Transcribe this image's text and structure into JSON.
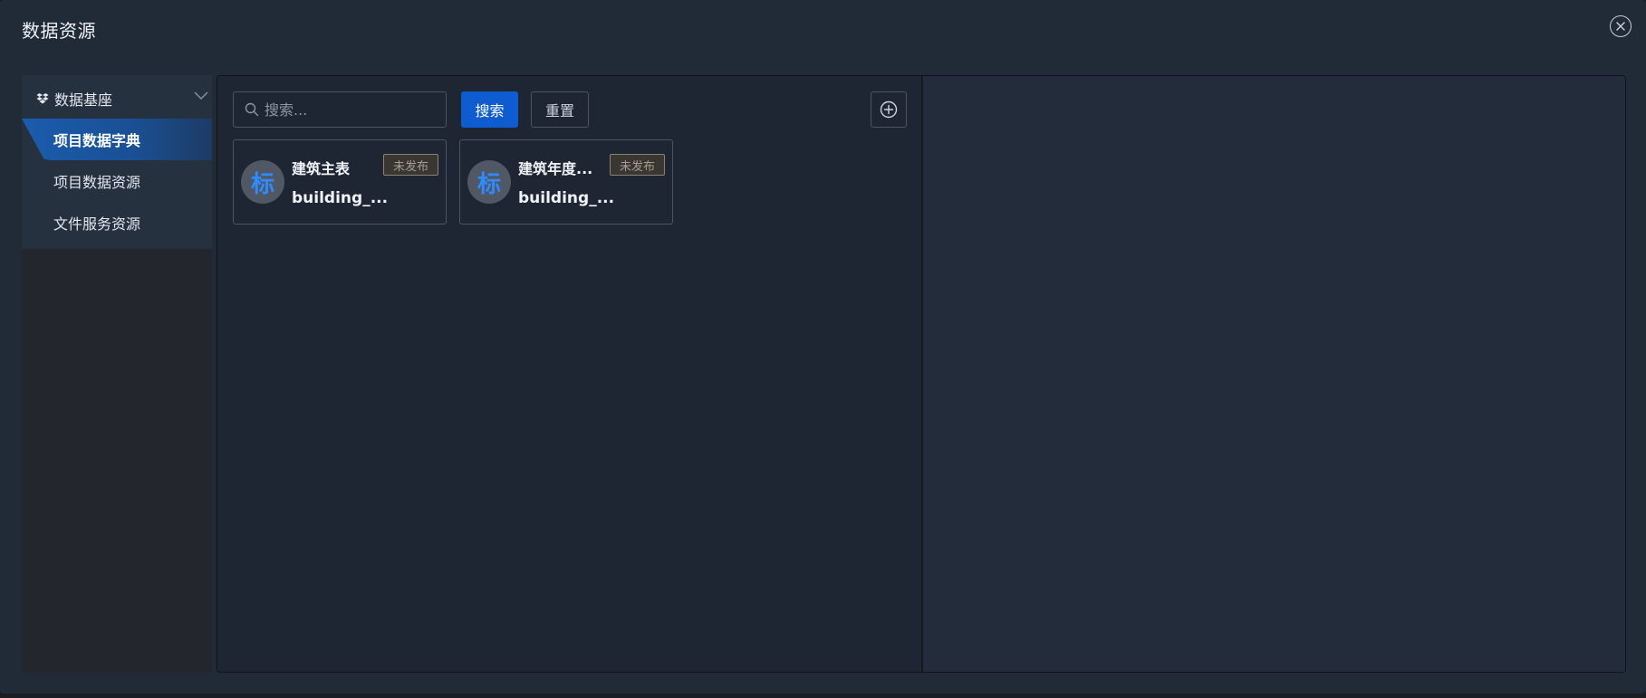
{
  "dialog": {
    "title": "数据资源",
    "close_icon": "close-circle-icon"
  },
  "sidebar": {
    "group": {
      "label": "数据基座",
      "icon": "dropbox-icon",
      "chevron": "chevron-down-icon"
    },
    "items": [
      {
        "label": "项目数据字典",
        "active": true
      },
      {
        "label": "项目数据资源",
        "active": false
      },
      {
        "label": "文件服务资源",
        "active": false
      }
    ]
  },
  "toolbar": {
    "search_placeholder": "搜索...",
    "search_label": "搜索",
    "reset_label": "重置",
    "add_icon": "plus-circle-icon"
  },
  "cards": [
    {
      "avatar": "标",
      "name": "建筑主表",
      "code": "building_...",
      "status": "未发布"
    },
    {
      "avatar": "标",
      "name": "建筑年度...",
      "code": "building_...",
      "status": "未发布"
    }
  ],
  "colors": {
    "accent": "#0f5bd0",
    "avatar_text": "#2f8bff",
    "background": "#212b38"
  }
}
